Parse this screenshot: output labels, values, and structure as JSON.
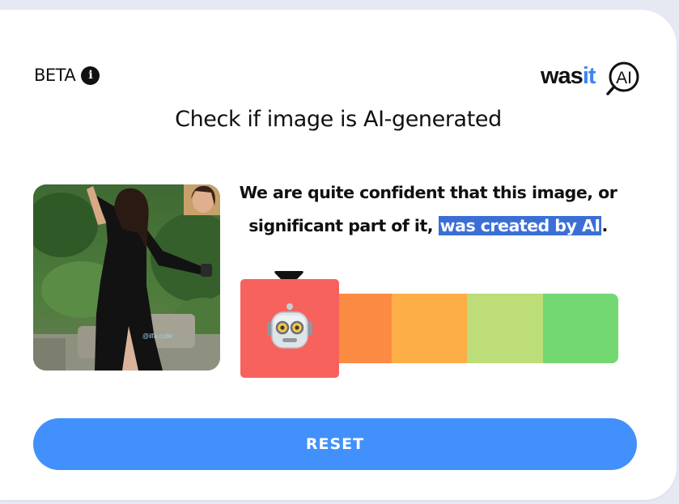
{
  "header": {
    "beta_label": "BETA",
    "info_icon": "info-icon",
    "logo_text_plain": "was",
    "logo_text_accent": "it",
    "logo_badge": "AI",
    "logo_accent_color": "#3b84f5"
  },
  "main": {
    "headline": "Check if image is AI-generated",
    "verdict_before": "We are quite confident that this image, or significant part of it,",
    "verdict_highlight": "was created by AI",
    "verdict_after": ".",
    "photo_watermark": "@ilfa.cutie",
    "meter": {
      "selected_index": 0,
      "selected_icon": "robot-face-icon",
      "segment_colors": [
        "#f8625d",
        "#fb8b43",
        "#fdae47",
        "#bcdd77",
        "#73d872"
      ]
    }
  },
  "actions": {
    "reset_label": "RESET"
  }
}
